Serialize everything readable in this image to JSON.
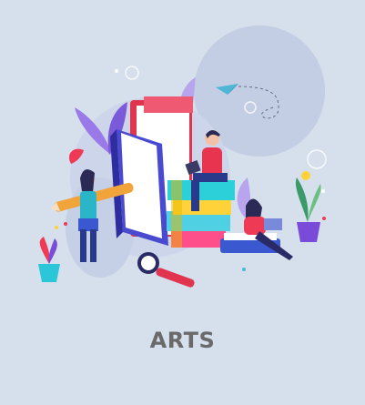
{
  "card": {
    "title": "ARTS",
    "illustration_icon": "books-and-readers-illustration"
  },
  "colors": {
    "background": "#d6dfec",
    "title_text": "#6a6a6a"
  }
}
